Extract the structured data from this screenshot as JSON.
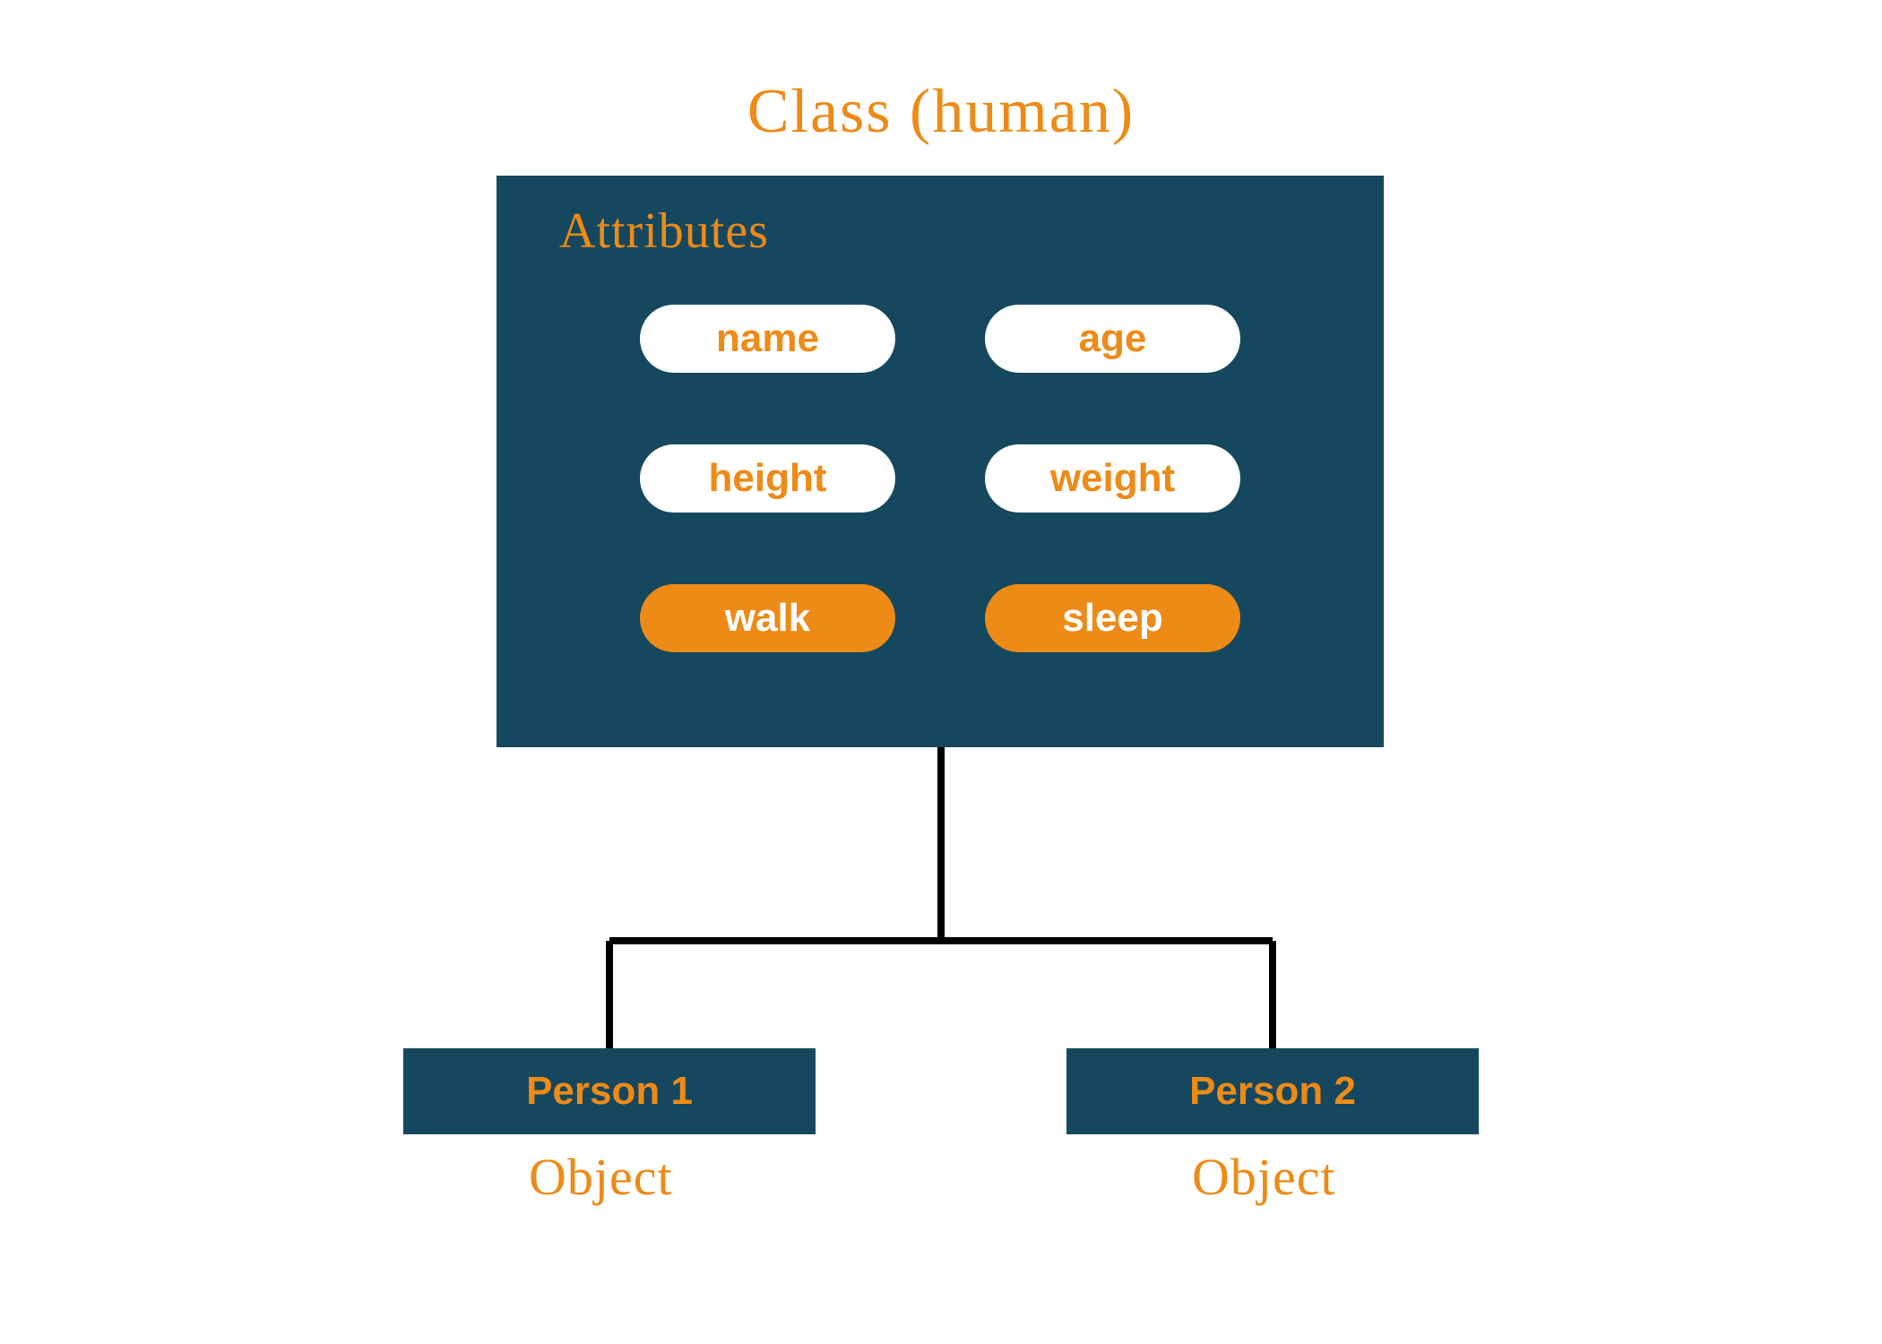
{
  "title": "Class (human)",
  "classBox": {
    "attributesLabel": "Attributes",
    "pills": {
      "p0": "name",
      "p1": "age",
      "p2": "height",
      "p3": "weight",
      "p4": "walk",
      "p5": "sleep"
    }
  },
  "objects": {
    "left": {
      "label": "Person 1",
      "caption": "Object"
    },
    "right": {
      "label": "Person 2",
      "caption": "Object"
    }
  }
}
